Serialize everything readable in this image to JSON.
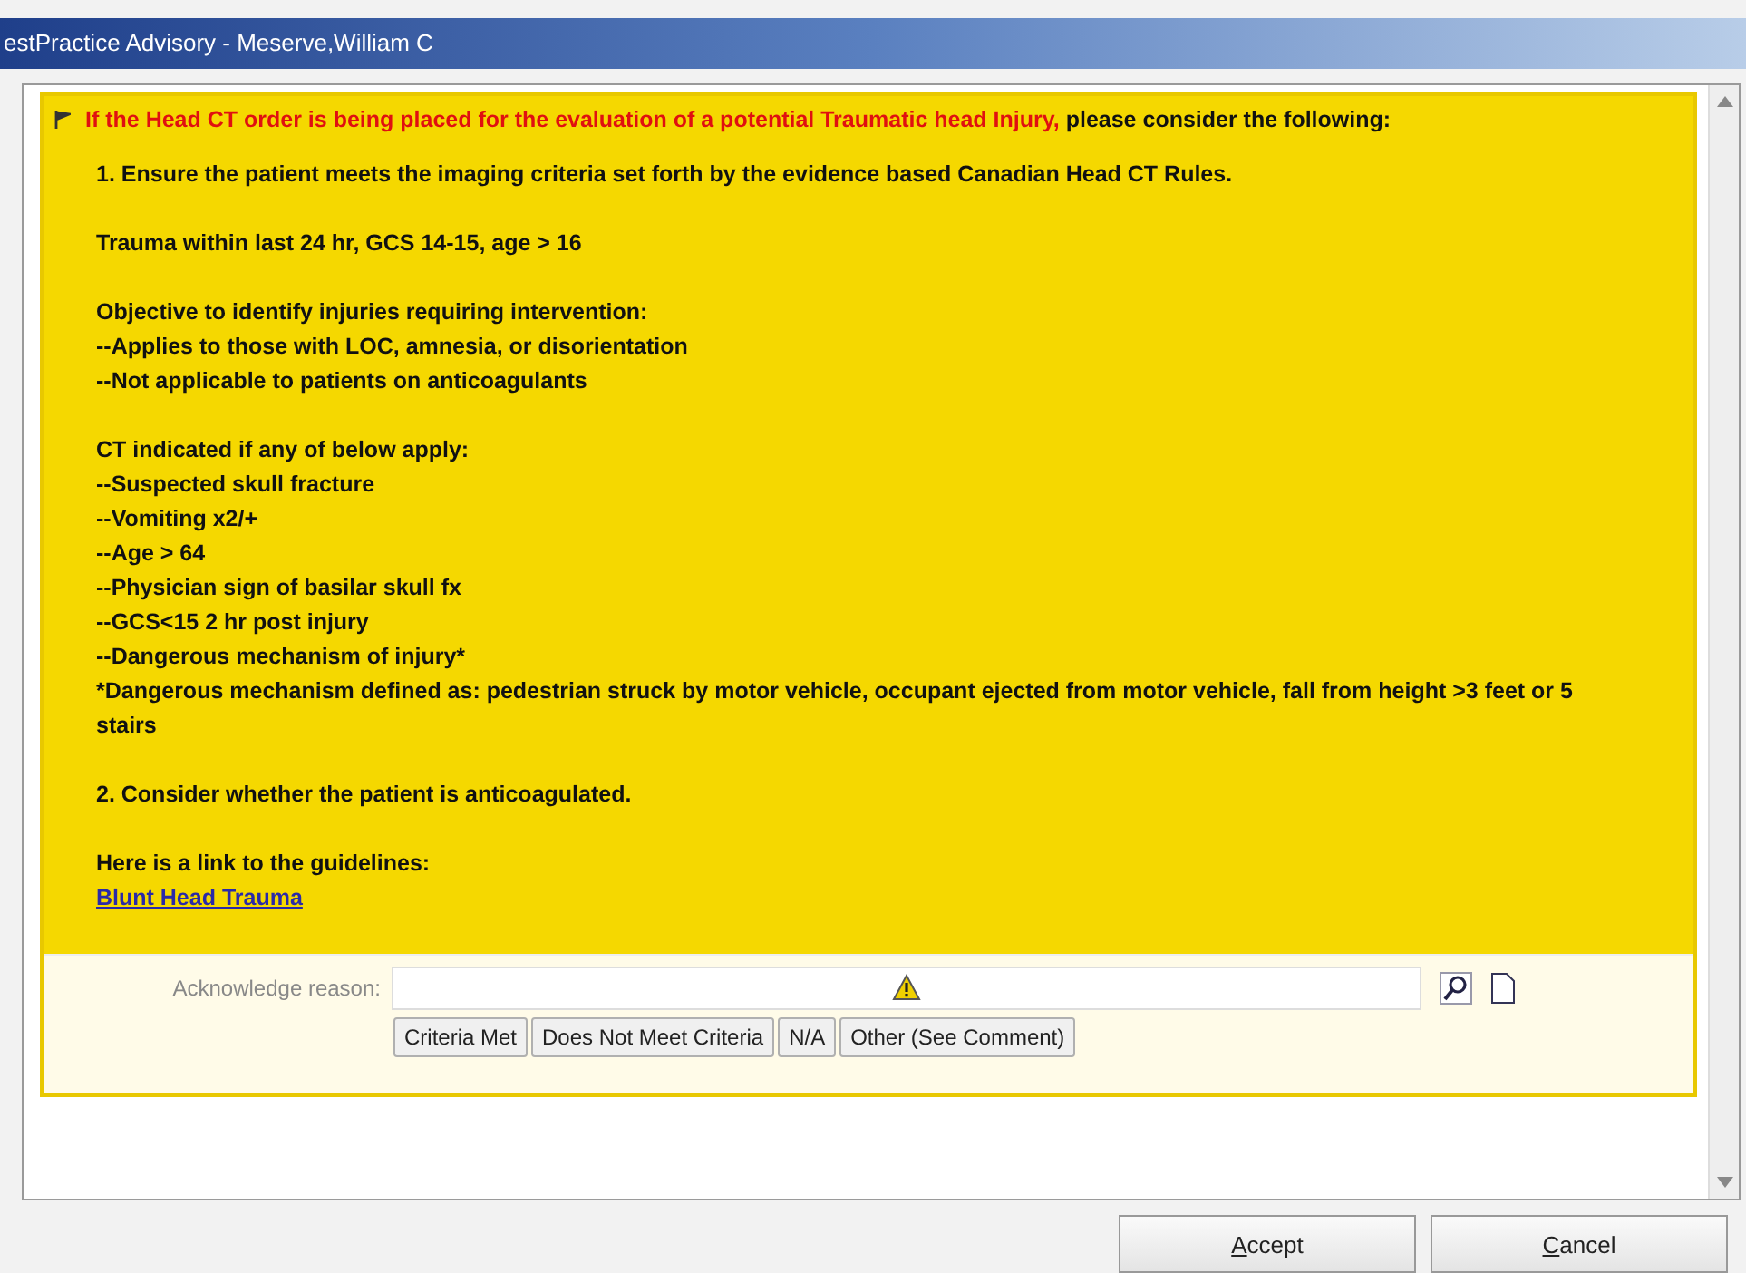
{
  "window": {
    "title": "estPractice Advisory  - Meserve,William C"
  },
  "advisory": {
    "heading_alert": "If the Head CT order is being placed for the evaluation of a potential Traumatic head Injury,",
    "heading_rest": "please consider the following:",
    "paragraphs": [
      [
        "1. Ensure the patient meets the imaging criteria set forth by the evidence based Canadian Head CT Rules."
      ],
      [
        "Trauma within last 24 hr, GCS 14-15, age > 16"
      ],
      [
        "Objective to identify injuries requiring intervention:",
        "--Applies to those with LOC, amnesia, or disorientation",
        "--Not applicable to patients on anticoagulants"
      ],
      [
        "CT indicated if any of below apply:",
        "--Suspected skull fracture",
        "--Vomiting x2/+",
        "--Age > 64",
        "--Physician sign of basilar skull fx",
        "--GCS<15 2 hr post injury",
        "--Dangerous mechanism of injury*",
        "*Dangerous mechanism defined as: pedestrian struck by motor vehicle, occupant ejected from motor vehicle, fall from height >3 feet or 5 stairs"
      ],
      [
        "2. Consider whether the patient is anticoagulated."
      ],
      [
        "Here is a link to the guidelines:"
      ]
    ],
    "link": "Blunt Head Trauma"
  },
  "acknowledge": {
    "label": "Acknowledge reason:",
    "options": [
      {
        "label": "Criteria Met",
        "selected": false
      },
      {
        "label": "Does Not Meet Criteria",
        "selected": false
      },
      {
        "label": "N/A",
        "selected": false
      },
      {
        "label": "Other (See Comment)",
        "selected": false
      }
    ]
  },
  "buttons": [
    "Accept",
    "Cancel"
  ]
}
